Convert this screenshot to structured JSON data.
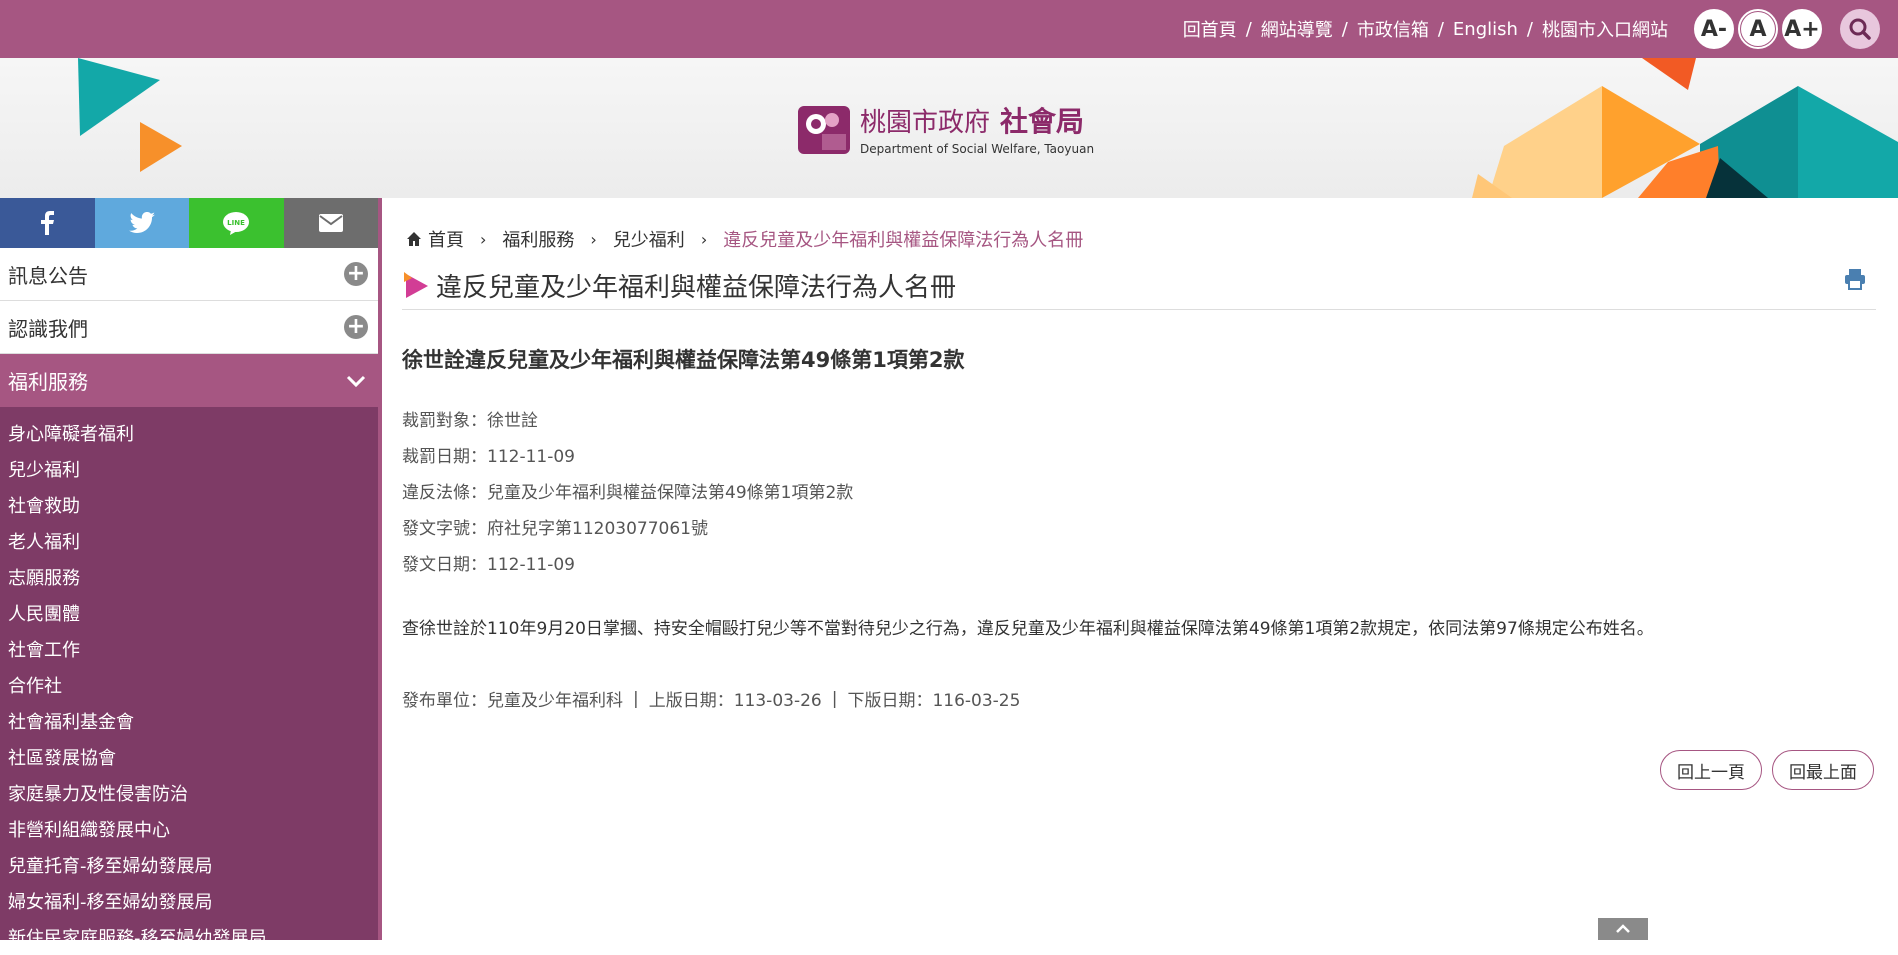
{
  "header": {
    "links": [
      "回首頁",
      "網站導覽",
      "市政信箱",
      "English",
      "桃園市入口網站"
    ],
    "font_small": "A-",
    "font_medium": "A",
    "font_large": "A+"
  },
  "logo": {
    "zh_city": "桃園市政府",
    "zh_dept": "社會局",
    "en": "Department of Social Welfare, Taoyuan"
  },
  "social": [
    "facebook-icon",
    "twitter-icon",
    "line-icon",
    "mail-icon"
  ],
  "sidebar": {
    "top_items": [
      "訊息公告",
      "認識我們"
    ],
    "active": "福利服務",
    "items": [
      "身心障礙者福利",
      "兒少福利",
      "社會救助",
      "老人福利",
      "志願服務",
      "人民團體",
      "社會工作",
      "合作社",
      "社會福利基金會",
      "社區發展協會",
      "家庭暴力及性侵害防治",
      "非營利組織發展中心",
      "兒童托育-移至婦幼發展局",
      "婦女福利-移至婦幼發展局",
      "新住民家庭服務-移至婦幼發展局"
    ]
  },
  "breadcrumb": [
    "首頁",
    "福利服務",
    "兒少福利",
    "違反兒童及少年福利與權益保障法行為人名冊"
  ],
  "page_title": "違反兒童及少年福利與權益保障法行為人名冊",
  "article": {
    "title": "徐世詮違反兒童及少年福利與權益保障法第49條第1項第2款",
    "fields": [
      "裁罰對象：徐世詮",
      "裁罰日期：112-11-09",
      "違反法條：兒童及少年福利與權益保障法第49條第1項第2款",
      "發文字號：府社兒字第11203077061號",
      "發文日期：112-11-09"
    ],
    "description": "查徐世詮於110年9月20日掌摑、持安全帽毆打兒少等不當對待兒少之行為，違反兒童及少年福利與權益保障法第49條第1項第2款規定，依同法第97條規定公布姓名。",
    "meta": [
      "發布單位：兒童及少年福利科",
      "上版日期：113-03-26",
      "下版日期：116-03-25"
    ]
  },
  "buttons": {
    "back": "回上一頁",
    "top": "回最上面"
  },
  "colors": {
    "brand": "#a65682",
    "sidebar": "#7e3b66"
  }
}
